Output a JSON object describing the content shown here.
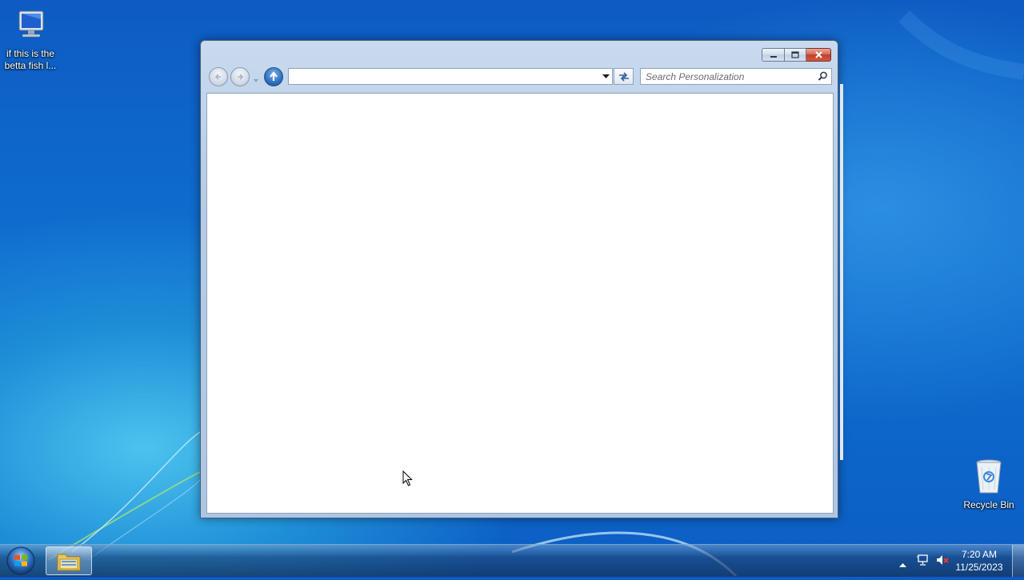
{
  "desktop": {
    "icons": [
      {
        "label": "if this is the betta fish l...",
        "icon": "computer-icon"
      },
      {
        "label": "Recycle Bin",
        "icon": "recycle-bin-icon"
      }
    ]
  },
  "window": {
    "address": {
      "value": ""
    },
    "search": {
      "placeholder": "Search Personalization"
    },
    "buttons": {
      "back": "back-icon",
      "forward": "forward-icon",
      "up": "up-arrow-icon",
      "refresh": "refresh-icon"
    }
  },
  "taskbar": {
    "pinned": [
      {
        "icon": "windows-explorer-icon"
      }
    ],
    "tray": {
      "icons": [
        "show-hidden-icons-icon",
        "network-icon",
        "volume-muted-icon"
      ]
    },
    "clock": {
      "time": "7:20 AM",
      "date": "11/25/2023"
    }
  },
  "colors": {
    "desktop_blue": "#0f6fd0",
    "close_red": "#c1412a",
    "window_frame": "#b7cde6"
  }
}
